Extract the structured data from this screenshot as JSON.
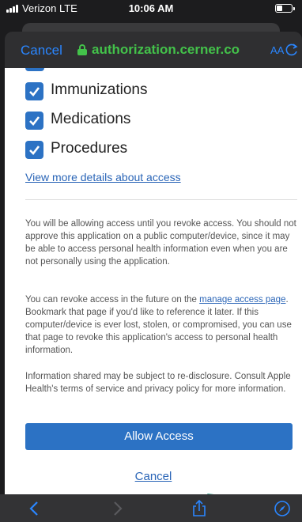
{
  "status_bar": {
    "carrier": "Verizon  LTE",
    "time": "10:06 AM",
    "battery_level": 0.4
  },
  "safari_header": {
    "cancel_label": "Cancel",
    "url": "authorization.cerner.co",
    "text_size_label": "AA"
  },
  "permissions": [
    {
      "label": "Immunizations",
      "checked": true
    },
    {
      "label": "Medications",
      "checked": true
    },
    {
      "label": "Procedures",
      "checked": true
    }
  ],
  "details_link": "View more details about access",
  "paragraphs": {
    "p1": "You will be allowing access until you revoke access. You should not approve this application on a public computer/device, since it may be able to access personal health information even when you are not personally using the application.",
    "p2_before": "You can revoke access in the future on the ",
    "p2_link": "manage access page",
    "p2_after": ". Bookmark that page if you'd like to reference it later. If this computer/device is ever lost, stolen, or compromised, you can use that page to revoke this application's access to personal health information.",
    "p3": "Information shared may be subject to re-disclosure. Consult Apple Health's terms of service and privacy policy for more information."
  },
  "allow_button": "Allow Access",
  "cancel_link": "Cancel",
  "colors": {
    "accent": "#2c72c4",
    "link": "#2a65b7",
    "secure_green": "#43c24a",
    "ios_blue": "#2a86ff",
    "arrow": "#1f9e87"
  },
  "toolbar_icons": [
    "back-icon",
    "forward-icon",
    "share-icon",
    "compass-icon"
  ]
}
